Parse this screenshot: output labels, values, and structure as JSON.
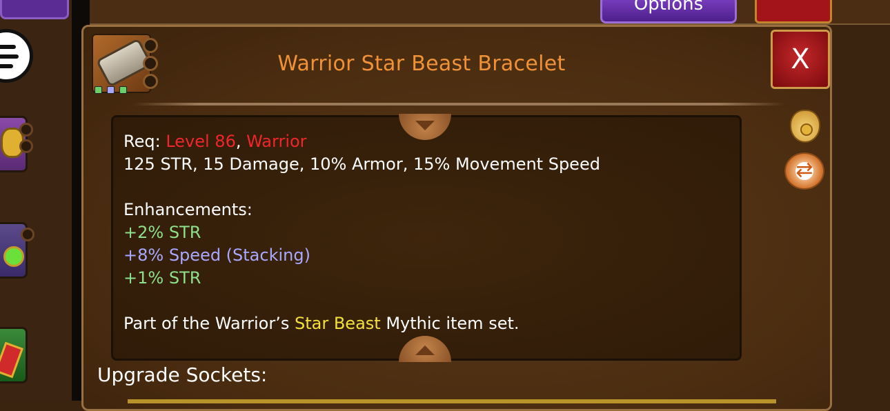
{
  "top_bar": {
    "options_label": "Options"
  },
  "item": {
    "name": "Warrior Star Beast Bracelet",
    "icon": "bracelet-icon",
    "gem_colors": [
      "#6ad06a",
      "#a8a8ff",
      "#6ad06a"
    ]
  },
  "close_label": "X",
  "details": {
    "req_prefix": "Req: ",
    "req_level": "Level 86",
    "req_sep": ", ",
    "req_class": "Warrior",
    "stats": "125 STR, 15 Damage, 10% Armor, 15% Movement Speed",
    "enh_header": "Enhancements:",
    "enh_1": "+2% STR",
    "enh_2": "+8% Speed (Stacking)",
    "enh_3": "+1% STR",
    "set_prefix": "Part of the Warrior’s ",
    "set_name": "Star Beast",
    "set_suffix": " Mythic item set."
  },
  "upgrade_label": "Upgrade Sockets:",
  "colors": {
    "title": "#f09238",
    "requirement": "#f0262a",
    "enhancement_green": "#8ee08a",
    "enhancement_lavender": "#a8a8ff",
    "set_highlight": "#f2e23a"
  },
  "icons": {
    "sell": "money-bag-icon",
    "swap": "swap-icon",
    "menu": "menu-icon"
  }
}
